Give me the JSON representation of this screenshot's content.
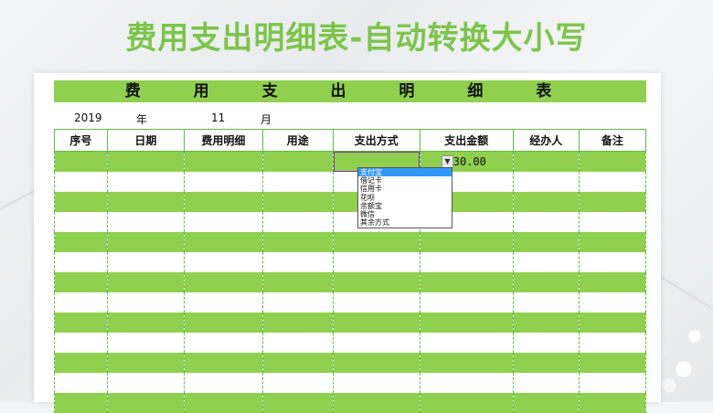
{
  "banner": {
    "title": "费用支出明细表-自动转换大小写"
  },
  "sheet": {
    "title": "费 用 支 出 明 细 表",
    "year": "2019",
    "year_label": "年",
    "month": "11",
    "month_label": "月",
    "columns": [
      "序号",
      "日期",
      "费用明细",
      "用途",
      "支出方式",
      "支出金额",
      "经办人",
      "备注"
    ],
    "first_row_amount": "230.00"
  },
  "dropdown": {
    "arrow": "▼",
    "options": [
      "支付宝",
      "借记卡",
      "信用卡",
      "花呗",
      "余额宝",
      "微信",
      "其余方式"
    ],
    "selected_index": 0
  },
  "colors": {
    "banner": "#7cc54a",
    "row_green": "#8fd04f",
    "selection": "#3399ff"
  }
}
